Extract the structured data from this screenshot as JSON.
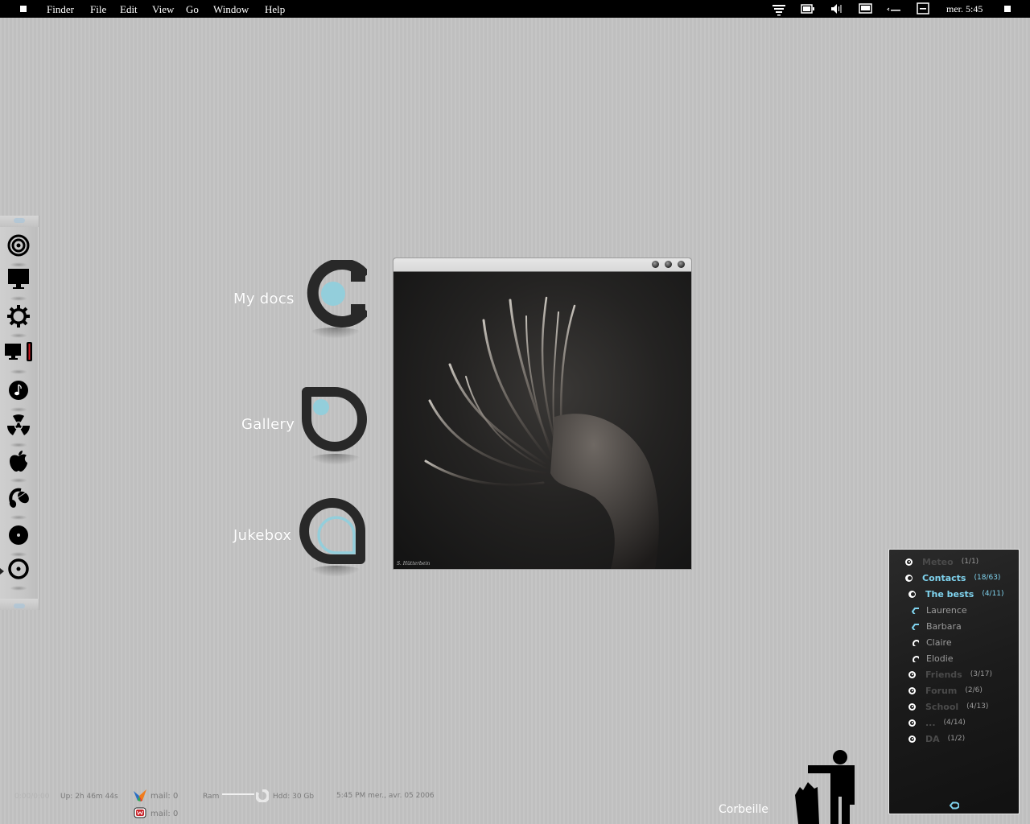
{
  "menubar": {
    "apple_icon": "square-menu-icon",
    "items": [
      "Finder",
      "File",
      "Edit",
      "View",
      "Go",
      "Window",
      "Help"
    ],
    "tray_icons": [
      "wifi-signal-icon",
      "battery-icon",
      "volume-icon",
      "display-icon",
      "terminal-icon",
      "minimize-window-icon"
    ],
    "clock": "mer. 5:45",
    "end_icon": "square-icon"
  },
  "dock": {
    "items": [
      {
        "name": "target-icon"
      },
      {
        "name": "monitor-icon"
      },
      {
        "name": "gear-icon"
      },
      {
        "name": "monitor-battery-icon"
      },
      {
        "name": "music-note-icon"
      },
      {
        "name": "radiation-icon"
      },
      {
        "name": "apple-icon"
      },
      {
        "name": "headphones-icon"
      },
      {
        "name": "cd-disc-icon"
      },
      {
        "name": "cd-ring-icon"
      }
    ]
  },
  "launchers": [
    {
      "label": "My docs",
      "icon": "c-shape-docs-icon"
    },
    {
      "label": "Gallery",
      "icon": "d-shape-gallery-icon"
    },
    {
      "label": "Jukebox",
      "icon": "drop-shape-jukebox-icon"
    }
  ],
  "photo_window": {
    "buttons": [
      "minimize",
      "maximize",
      "close"
    ],
    "credit": "S. Hütterbein"
  },
  "contacts": {
    "accent": "#7fd3ee",
    "rows": [
      {
        "type": "group",
        "label": "Meteo",
        "count": "(1/1)",
        "active": false,
        "indent": 0
      },
      {
        "type": "group",
        "label": "Contacts",
        "count": "(18/63)",
        "active": true,
        "indent": 0
      },
      {
        "type": "group",
        "label": "The bests",
        "count": "(4/11)",
        "active": true,
        "indent": 1
      },
      {
        "type": "person",
        "label": "Laurence",
        "online": true
      },
      {
        "type": "person",
        "label": "Barbara",
        "online": true
      },
      {
        "type": "person",
        "label": "Claire",
        "online": false
      },
      {
        "type": "person",
        "label": "Elodie",
        "online": false
      },
      {
        "type": "group",
        "label": "Friends",
        "count": "(3/17)",
        "active": false,
        "indent": 1
      },
      {
        "type": "group",
        "label": "Forum",
        "count": "(2/6)",
        "active": false,
        "indent": 1
      },
      {
        "type": "group",
        "label": "School",
        "count": "(4/13)",
        "active": false,
        "indent": 1
      },
      {
        "type": "group",
        "label": "...",
        "count": "(4/14)",
        "active": false,
        "indent": 1
      },
      {
        "type": "group",
        "label": "DA",
        "count": "(1/2)",
        "active": false,
        "indent": 1
      }
    ],
    "footer_icon": "status-ring-icon"
  },
  "trash": {
    "label": "Corbeille",
    "icon": "trash-person-icon"
  },
  "stats": {
    "media_time": "0:00/0:00",
    "uptime": "Up: 2h 46m 44s",
    "msn_mail": "mail: 0",
    "webmail_mail": "mail: 0",
    "ram_label": "Ram",
    "hdd": "Hdd: 30 Gb",
    "datetime": "5:45 PM  mer., avr. 05 2006"
  }
}
